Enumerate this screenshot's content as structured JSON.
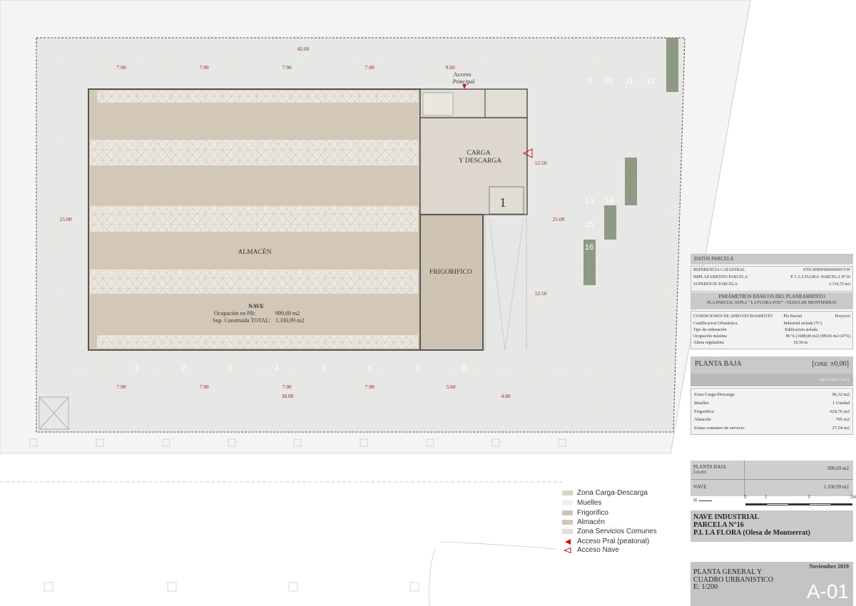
{
  "plan": {
    "dims": {
      "top_total": "42.00",
      "top_bays": [
        "7.90",
        "7.90",
        "7.90",
        "7.90",
        "9.60"
      ],
      "bottom_bays": [
        "7.90",
        "7.90",
        "7.90",
        "7.90",
        "5.60",
        "4.00"
      ],
      "bottom_total": "38.00",
      "left_height": "25.00",
      "right_height": "25.00",
      "right_upper": "12.50",
      "right_lower": "12.50"
    },
    "rooms": {
      "almacen": "ALMACÉN",
      "carga_1": "CARGA",
      "carga_2": "Y DESCARGA",
      "frigorifico": "FRIGORIFICO",
      "muelle_number": "1",
      "acceso_1": "Acceso",
      "acceso_2": "Principal"
    },
    "nave_box": {
      "title": "NAVE",
      "ocupacion_label": "Ocupación en PB:",
      "ocupacion_value": "999,69 m2",
      "construida_label": "Sup. Construida TOTAL:",
      "construida_value": "1.330,99 m2"
    },
    "parking_top": [
      "9",
      "10",
      "11",
      "12"
    ],
    "parking_side": [
      "13",
      "14",
      "15",
      "16"
    ],
    "parking_bottom": [
      "1",
      "2",
      "3",
      "4",
      "5",
      "6",
      "7",
      "8"
    ]
  },
  "legend": [
    {
      "label": "Zona Carga-Descarga",
      "color": "#d8d2c8"
    },
    {
      "label": "Muelles",
      "color": "#eeeeec"
    },
    {
      "label": "Frigorifico",
      "color": "#cfc4b4"
    },
    {
      "label": "Almacén",
      "color": "#d3c8b8"
    },
    {
      "label": "Zona Servicios Comunes",
      "color": "#e2ded6"
    },
    {
      "label": "Acceso Pral (peatonal)",
      "color": "#cc1111"
    },
    {
      "label": "Acceso Nave",
      "color": "#cc1111"
    }
  ],
  "datos_parcela": {
    "title": "DATOS PARCELA",
    "rows": [
      {
        "label": "REFERENCIA CATASTRAL",
        "value": "6701309DF0060S0001YW"
      },
      {
        "label": "IMPLAZAMENTO PARCELA",
        "value": "P. I. LA FLORA- PARCELA N°16"
      },
      {
        "label": "SUPERFICIE PARCELA",
        "value": "2.110,72 m2"
      }
    ]
  },
  "parametros": {
    "title": "PARÁMETROS BÁSICOS DEL PLANEAMIENTO",
    "subtitle": "PLA PARCIAL SUPi.2 \" LA FLORA-FOU\" - OLESA DE MONTSERRAT",
    "head_label": "CONDICIONES DE APROVECHAMIENTO",
    "head_col1": "Pla Parcial",
    "head_col2": "Proyecto",
    "rows": [
      {
        "label": "Cualificacion Urbanistica",
        "value": "Industrial aislada (7C)"
      },
      {
        "label": "Tipo de ordenación",
        "value": "Edificacion aislada"
      },
      {
        "label": "Ocupación máxima",
        "value": "80 % (1688,00 m2)     999,66 m2 (47%)"
      },
      {
        "label": "Altura reguladora",
        "value": "10,50 m"
      }
    ]
  },
  "planta_baja": {
    "title": "PLANTA BAJA",
    "cota": "[cota: ±0,00]",
    "sup_label": "Sup. Const. [ m2]",
    "rows": [
      {
        "label": "Zona Carga-Descarga",
        "value": "96,32 m2"
      },
      {
        "label": "Muelles",
        "value": "1 Unidad"
      },
      {
        "label": "Frigorifico",
        "value": "624,76 m3"
      },
      {
        "label": "Almacén",
        "value": "795 m2"
      },
      {
        "label": "Zonas comunes de servicio",
        "value": "27,54 m2"
      }
    ]
  },
  "totales": {
    "pb_label_1": "PLANTA BAJA",
    "pb_label_2": "[±0,00]",
    "pb_value": "999,69 m2",
    "nave_label": "NAVE",
    "nave_value": "1.330,99 m2"
  },
  "scale": {
    "north": "N",
    "ticks": [
      "0",
      "1",
      "3",
      "5m"
    ]
  },
  "project": {
    "line1": "NAVE INDUSTRIAL",
    "line2": "PARCELA N°16",
    "line3": "P.I. LA FLORA  (Olesa de Montserrat)"
  },
  "sheet": {
    "date": "Noviembre 2019",
    "title1": "PLANTA GENERAL Y",
    "title2": "CUADRO URBANISTICO",
    "scale": "E: 1/200",
    "code": "A-01"
  }
}
